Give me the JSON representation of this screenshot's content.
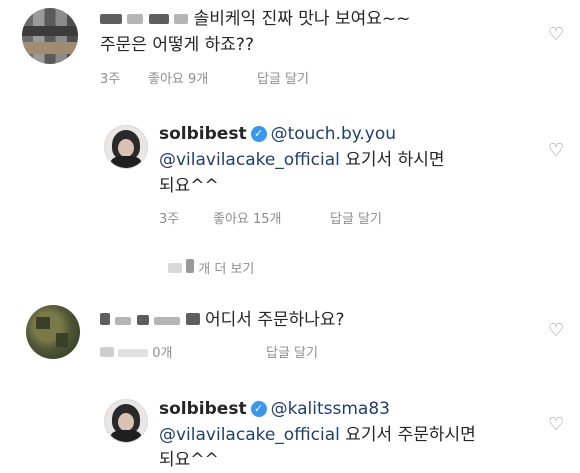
{
  "comments": [
    {
      "text_line1": "솔비케익 진짜 맛나 보여요~~",
      "text_line2": "주문은 어떻게 하죠??",
      "time": "3주",
      "likes": "좋아요 9개",
      "reply": "답글 달기"
    },
    {
      "text": "어디서 주문하나요?",
      "likes_partial": "0개",
      "reply": "답글 달기"
    }
  ],
  "replies": [
    {
      "username": "solbibest",
      "mention1": "@touch.by.you",
      "mention2": "@vilavilacake_official",
      "text_after": " 요기서 하시면",
      "text_line3": "되요^^",
      "time": "3주",
      "likes": "좋아요 15개",
      "reply": "답글 달기"
    },
    {
      "username": "solbibest",
      "mention1": "@kalitssma83",
      "mention2": "@vilavilacake_official",
      "text_after": " 요기서 주문하시면",
      "text_line3": "되요^^"
    }
  ],
  "view_more": "개 더 보기",
  "icons": {
    "heart": "heart-outline-icon",
    "verified": "verified-badge-icon"
  },
  "colors": {
    "mention": "#1f3f6e",
    "meta": "#8e8e8e",
    "verified": "#3897f0"
  }
}
